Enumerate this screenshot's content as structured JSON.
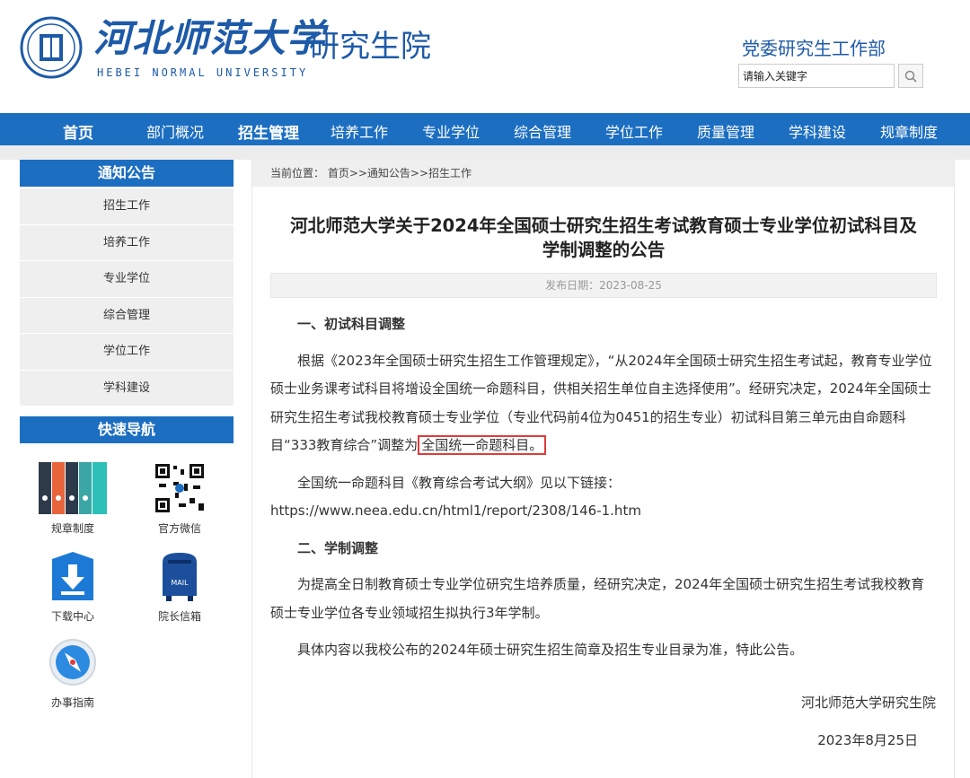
{
  "header": {
    "logo_cn": "河北师范大学",
    "logo_en": "HEBEI NORMAL UNIVERSITY",
    "logo_sub": "研究生院",
    "dept": "党委研究生工作部",
    "search_placeholder": "请输入关键字",
    "search_value": "请输入关键字"
  },
  "nav": [
    {
      "label": "首页"
    },
    {
      "label": "部门概况"
    },
    {
      "label": "招生管理"
    },
    {
      "label": "培养工作"
    },
    {
      "label": "专业学位"
    },
    {
      "label": "综合管理"
    },
    {
      "label": "学位工作"
    },
    {
      "label": "质量管理"
    },
    {
      "label": "学科建设"
    },
    {
      "label": "规章制度"
    }
  ],
  "sidebar": {
    "notice_title": "通知公告",
    "items": [
      "招生工作",
      "培养工作",
      "专业学位",
      "综合管理",
      "学位工作",
      "学科建设"
    ],
    "quick_title": "快速导航",
    "quick": [
      "规章制度",
      "官方微信",
      "下载中心",
      "院长信箱",
      "办事指南"
    ]
  },
  "article": {
    "breadcrumb": "当前位置： 首页>>通知公告>>招生工作",
    "title_line1": "河北师范大学关于2024年全国硕士研究生招生考试教育硕士专业学位初试科目及",
    "title_line2": "学制调整的公告",
    "date": "发布日期：2023-08-25",
    "h1": "一、初试科目调整",
    "p1": "根据《2023年全国硕士研究生招生工作管理规定》，“从2024年全国硕士研究生招生考试起，教育专业学位硕士业务课考试科目将增设全国统一命题科目，供相关招生单位自主选择使用”。经研究决定，2024年全国硕士研究生招生考试我校教育硕士专业学位（专业代码前4位为0451的招生专业）初试科目第三单元由自命题科目“333教育综合”调整为",
    "p1_highlight": "全国统一命题科目。",
    "p2": "全国统一命题科目《教育综合考试大纲》见以下链接：",
    "link": "https://www.neea.edu.cn/html1/report/2308/146-1.htm",
    "h2": "二、学制调整",
    "p3": "为提高全日制教育硕士专业学位研究生培养质量，经研究决定，2024年全国硕士研究生招生考试我校教育硕士专业学位各专业领域招生拟执行3年学制。",
    "p4": "具体内容以我校公布的2024年硕士研究生招生简章及招生专业目录为准，特此公告。",
    "sign_org": "河北师范大学研究生院",
    "sign_date": "2023年8月25日"
  },
  "colors": {
    "brand": "#1c6ec1",
    "highlight_border": "#e03b3b"
  }
}
